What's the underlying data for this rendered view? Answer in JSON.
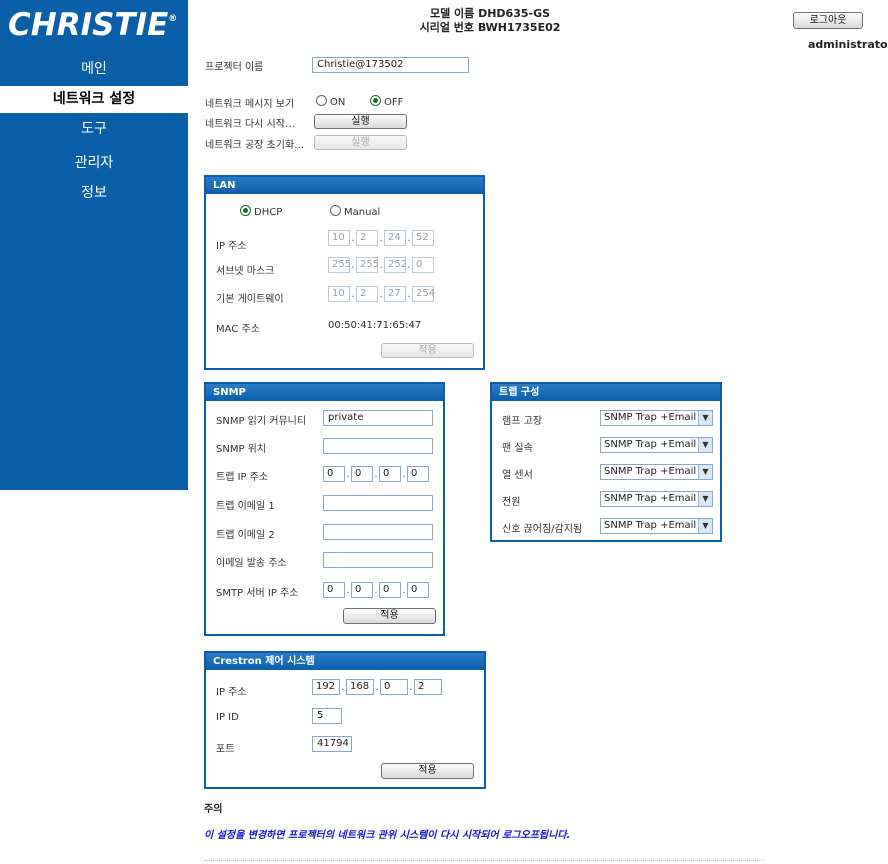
{
  "sidebar": {
    "logo": "CHRISTIE",
    "logo_mark": "®",
    "items": [
      {
        "label": "메인"
      },
      {
        "label": "네트워크 설정"
      },
      {
        "label": "도구"
      },
      {
        "label": "관리자"
      },
      {
        "label": "정보"
      }
    ],
    "active_index": 1
  },
  "header": {
    "model_line": "모델 이름 DHD635-GS",
    "serial_line": "시리얼 번호 BWH1735E02",
    "logout_label": "로그아웃",
    "user": "administrator"
  },
  "general": {
    "projector_name_label": "프로젝터 이름",
    "projector_name_value": "Christie@173502",
    "net_msg_label": "네트워크 메시지 보기",
    "on_label": "ON",
    "off_label": "OFF",
    "net_msg_selected": "OFF",
    "restart_label": "네트워크 다시 시작…",
    "restart_btn": "실행",
    "factory_label": "네트워크 공장 초기화…",
    "factory_btn": "실행"
  },
  "lan": {
    "title": "LAN",
    "dhcp_label": "DHCP",
    "manual_label": "Manual",
    "mode_selected": "DHCP",
    "ip_label": "IP 주소",
    "ip": [
      "10",
      "2",
      "24",
      "52"
    ],
    "subnet_label": "서브넷 마스크",
    "subnet": [
      "255",
      "255",
      "252",
      "0"
    ],
    "gateway_label": "기본 게이트웨이",
    "gateway": [
      "10",
      "2",
      "27",
      "254"
    ],
    "mac_label": "MAC 주소",
    "mac_value": "00:50:41:71:65:47",
    "apply_btn": "적용"
  },
  "snmp": {
    "title": "SNMP",
    "read_community_label": "SNMP 읽기 커뮤니티",
    "read_community_value": "private",
    "location_label": "SNMP 위치",
    "location_value": "",
    "trap_ip_label": "트랩 IP 주소",
    "trap_ip": [
      "0",
      "0",
      "0",
      "0"
    ],
    "trap_email1_label": "트랩 이메일 1",
    "trap_email1_value": "",
    "trap_email2_label": "트랩 이메일 2",
    "trap_email2_value": "",
    "sender_label": "이메일 발송 주소",
    "sender_value": "",
    "smtp_ip_label": "SMTP 서버 IP 주소",
    "smtp_ip": [
      "0",
      "0",
      "0",
      "0"
    ],
    "apply_btn": "적용"
  },
  "trap": {
    "title": "트랩 구성",
    "rows": [
      {
        "label": "램프 고장",
        "value": "SNMP Trap +Email"
      },
      {
        "label": "팬 실속",
        "value": "SNMP Trap +Email"
      },
      {
        "label": "열 센서",
        "value": "SNMP Trap +Email"
      },
      {
        "label": "전원",
        "value": "SNMP Trap +Email"
      },
      {
        "label": "신호 끊어짐/감지됨",
        "value": "SNMP Trap +Email"
      }
    ]
  },
  "crestron": {
    "title": "Crestron 제어 시스템",
    "ip_label": "IP 주소",
    "ip": [
      "192",
      "168",
      "0",
      "2"
    ],
    "ipid_label": "IP ID",
    "ipid_value": "5",
    "port_label": "포트",
    "port_value": "41794",
    "apply_btn": "적용"
  },
  "notes": {
    "heading": "주의",
    "text": "이 설정을 변경하면 프로젝터의 네트워크 관위 시스템이 다시 시작되어 로그오프됩니다."
  }
}
